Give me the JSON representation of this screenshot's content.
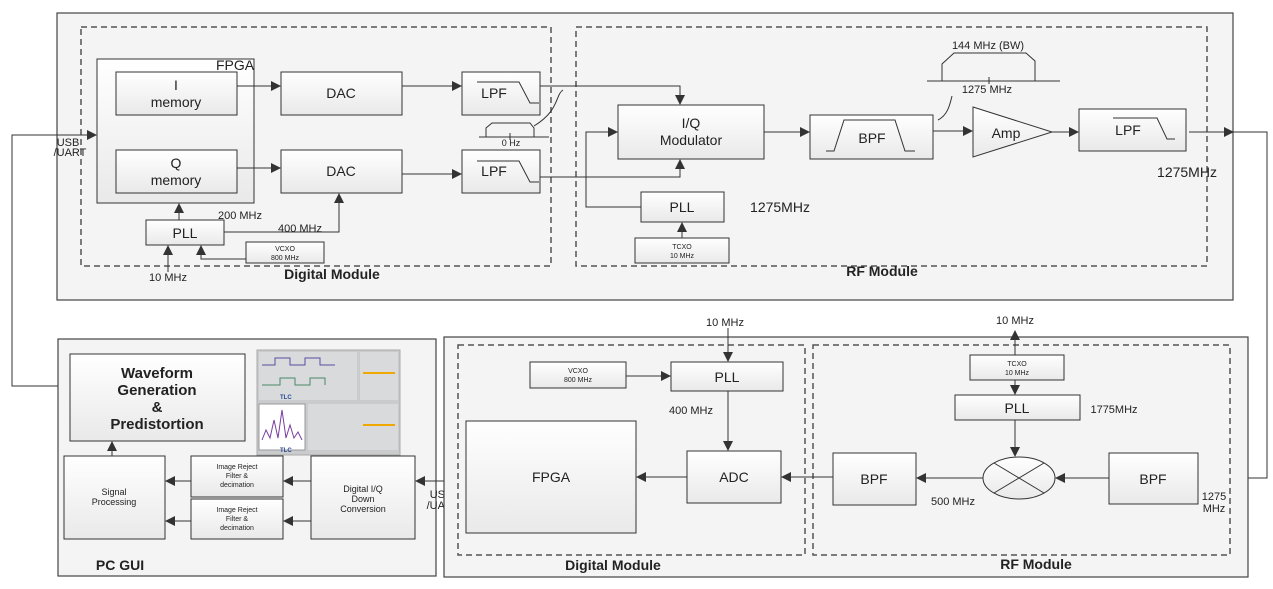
{
  "tx": {
    "fpga_label": "FPGA",
    "i_memory": [
      "I",
      "memory"
    ],
    "q_memory": [
      "Q",
      "memory"
    ],
    "dac": "DAC",
    "lpf": "LPF",
    "pll": "PLL",
    "vcxo": [
      "VCXO",
      "800 MHz"
    ],
    "clk_200": "200 MHz",
    "clk_400": "400 MHz",
    "ref_10": "10 MHz",
    "zero_hz": "0 Hz",
    "usb_uart": [
      "USB",
      "/UART"
    ],
    "digital_module": "Digital Module",
    "iq_modulator": [
      "I/Q",
      "Modulator"
    ],
    "bpf": "BPF",
    "amp": "Amp",
    "bw_label": "144 MHz (BW)",
    "center_freq": "1275 MHz",
    "pll_freq": "1275MHz",
    "tcxo": [
      "TCXO",
      "10 MHz"
    ],
    "output_freq": "1275MHz",
    "rf_module": "RF Module"
  },
  "pc": {
    "waveform": [
      "Waveform",
      "Generation",
      "&",
      "Predistortion"
    ],
    "signal_processing": [
      "Signal",
      "Processing"
    ],
    "image_reject": [
      "Image Reject",
      "Filter &",
      "decimation"
    ],
    "ddc": [
      "Digital I/Q",
      "Down",
      "Conversion"
    ],
    "usb_uart": [
      "USB",
      "/UART"
    ],
    "title": "PC GUI",
    "gui_logo": "TLC"
  },
  "rx": {
    "ref_10": "10 MHz",
    "vcxo": [
      "VCXO",
      "800 MHz"
    ],
    "pll": "PLL",
    "clk_400": "400 MHz",
    "fpga": "FPGA",
    "adc": "ADC",
    "bpf": "BPF",
    "if_freq": "500 MHz",
    "tcxo": [
      "TCXO",
      "10 MHz"
    ],
    "tcxo_out": "10 MHz",
    "lo_freq": "1775MHz",
    "rf_in": [
      "1275",
      "MHz"
    ],
    "digital_module": "Digital Module",
    "rf_module": "RF Module"
  }
}
